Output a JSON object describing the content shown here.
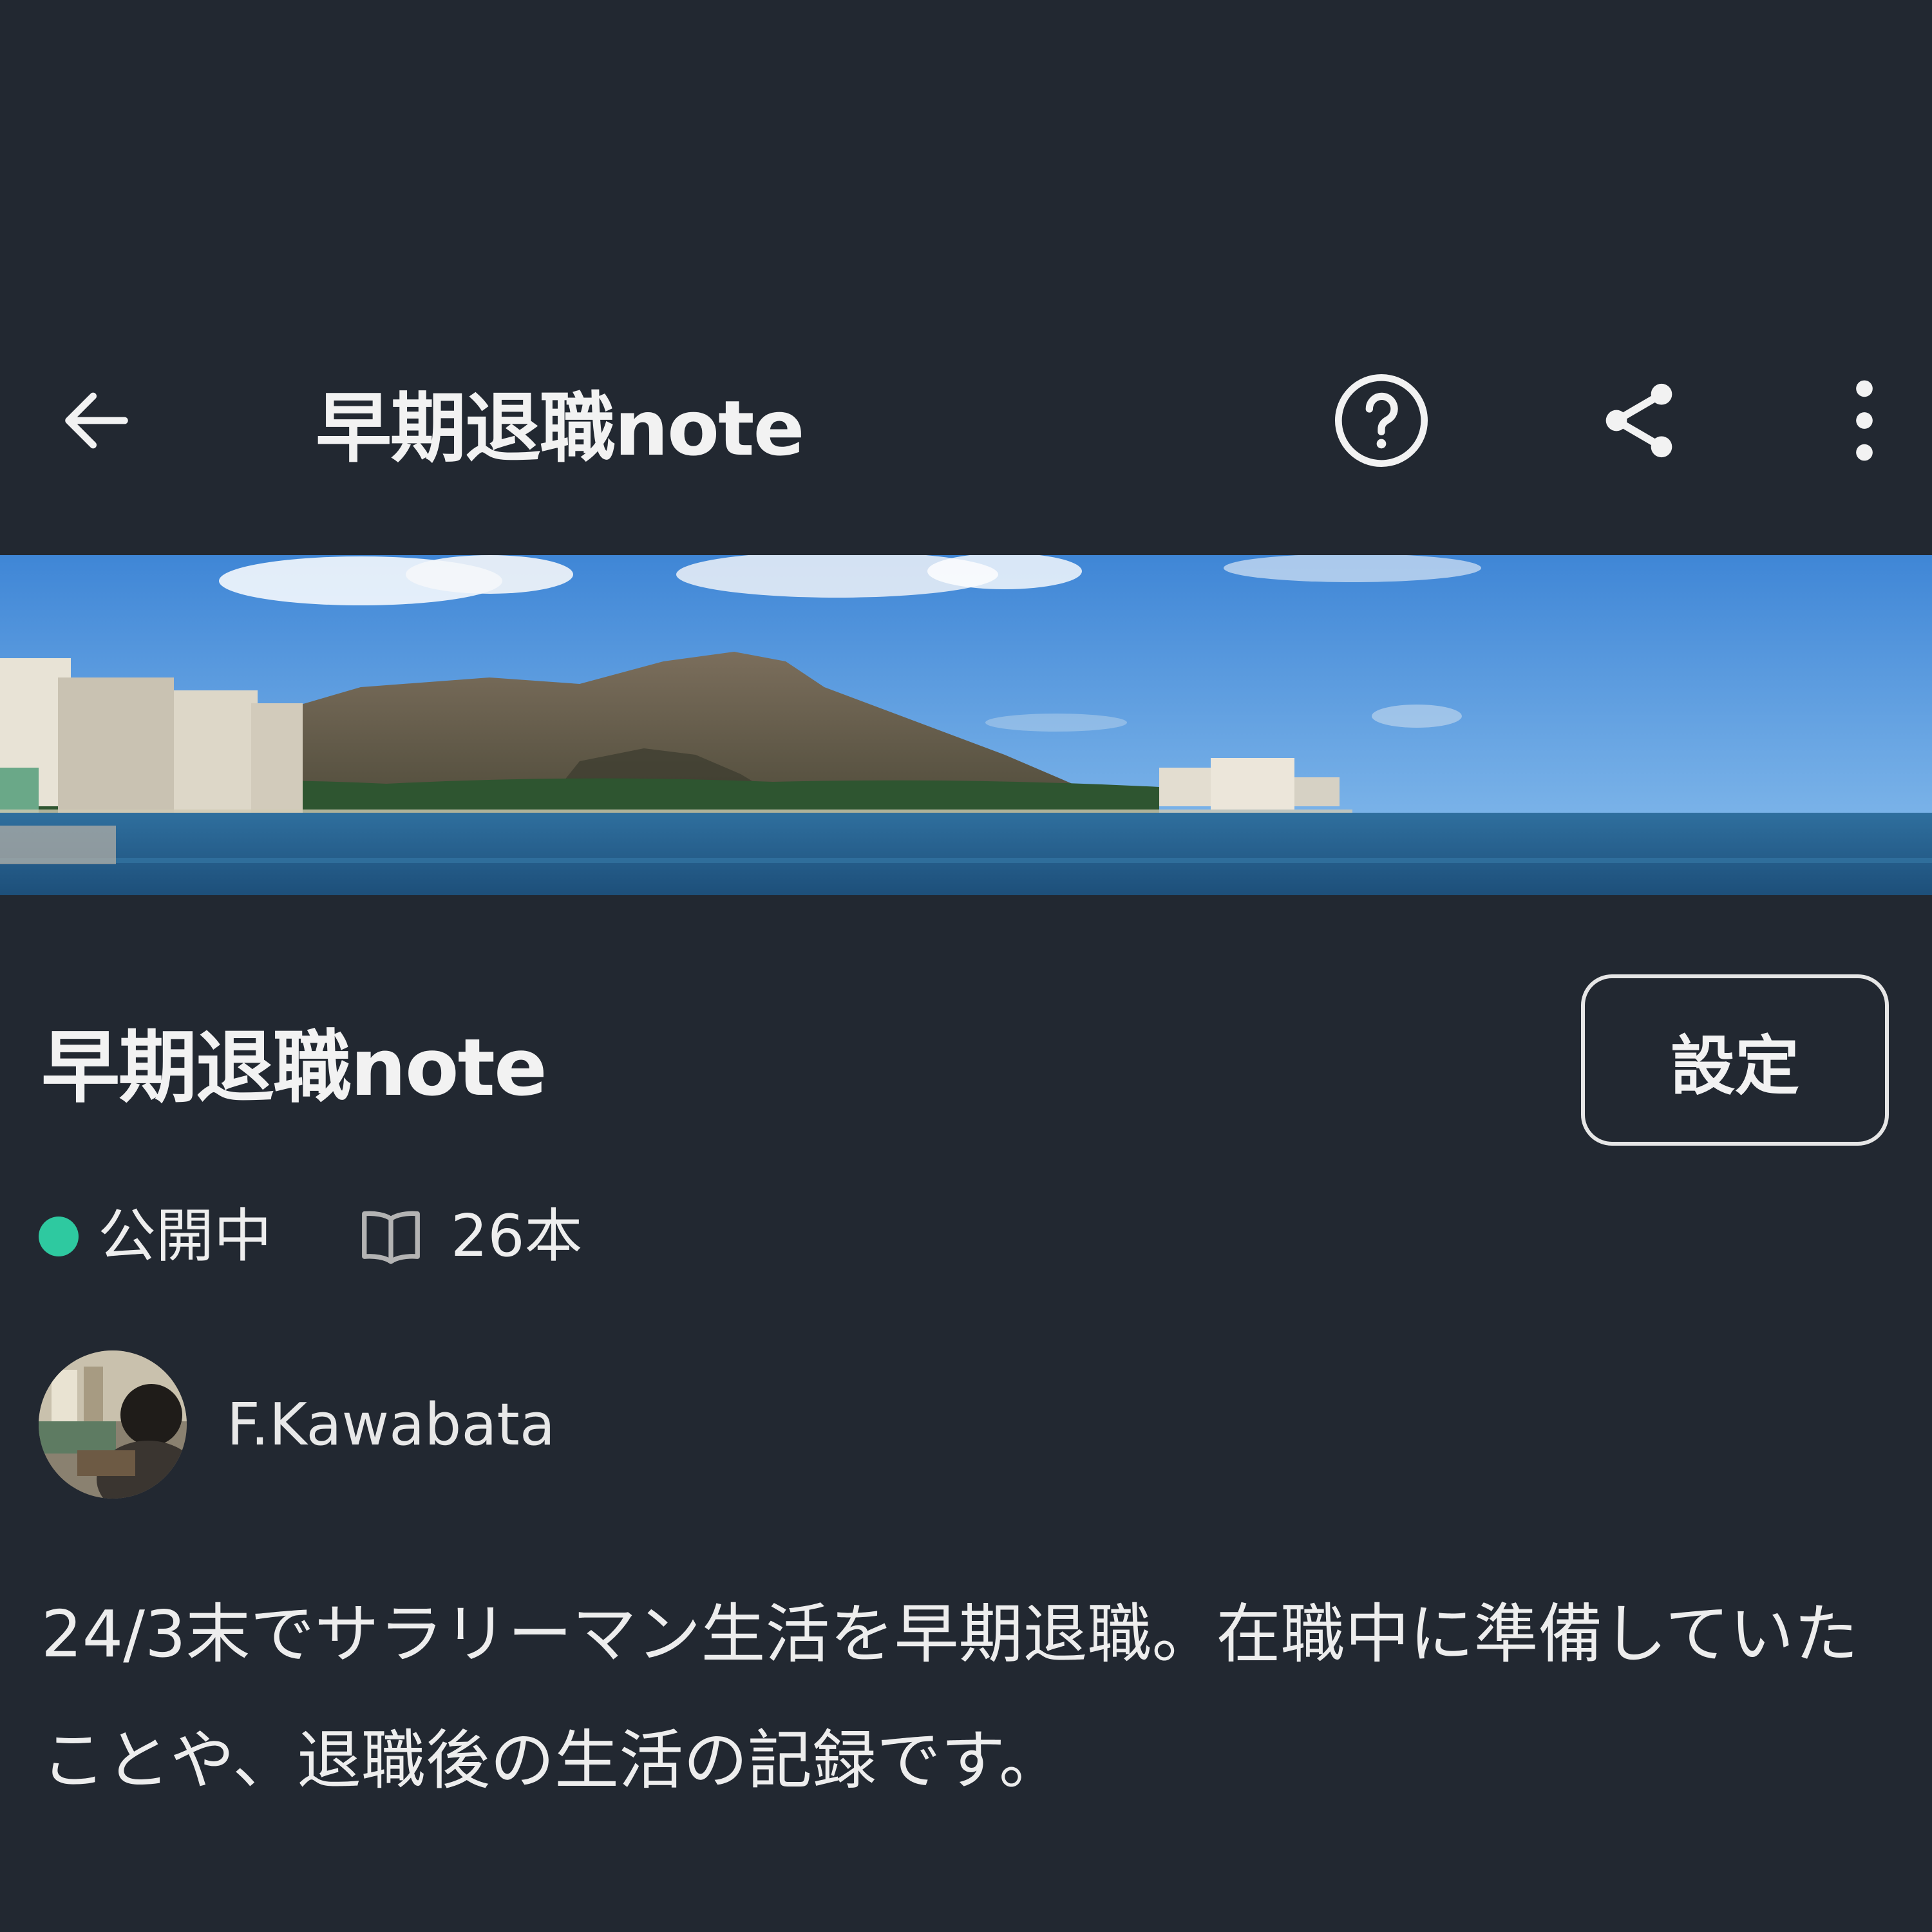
{
  "app_bar": {
    "title": "早期退職note",
    "back_icon": "arrow-left-icon",
    "help_icon": "question-circle-icon",
    "share_icon": "share-icon",
    "more_icon": "more-vertical-icon"
  },
  "cover": {
    "icon": "cover-image"
  },
  "magazine": {
    "title": "早期退職note",
    "settings_label": "設定",
    "status_label": "公開中",
    "status_color": "#2ec9a0",
    "article_count": "26本",
    "book_icon": "book-open-icon"
  },
  "author": {
    "name": "F.Kawabata",
    "avatar_icon": "avatar-photo"
  },
  "description": "24/3末でサラリーマン生活を早期退職。在職中に準備していたことや、退職後の生活の記録です。",
  "colors": {
    "background": "#222831",
    "text": "#f2f2f2",
    "accent": "#2ec9a0"
  }
}
